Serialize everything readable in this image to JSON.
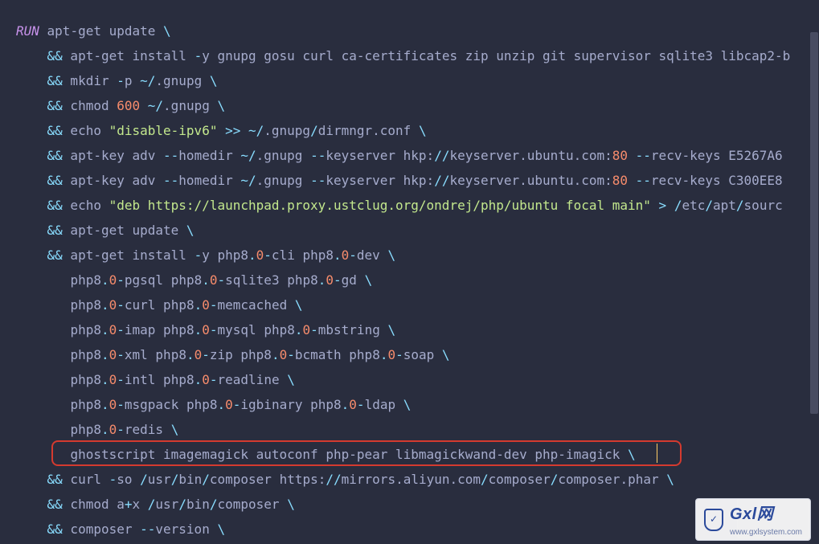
{
  "code": {
    "run_kw": "RUN",
    "lines": [
      {
        "indent": 0,
        "prefix_kw": true,
        "amp": false,
        "segs": [
          {
            "t": "txt",
            "v": " apt-get update "
          },
          {
            "t": "op",
            "v": "\\"
          }
        ]
      },
      {
        "indent": 4,
        "amp": true,
        "segs": [
          {
            "t": "txt",
            "v": " apt-get install "
          },
          {
            "t": "op",
            "v": "-"
          },
          {
            "t": "txt",
            "v": "y gnupg gosu curl ca-certificates zip unzip git supervisor sqlite3 libcap2-b"
          }
        ]
      },
      {
        "indent": 4,
        "amp": true,
        "segs": [
          {
            "t": "txt",
            "v": " mkdir "
          },
          {
            "t": "op",
            "v": "-"
          },
          {
            "t": "txt",
            "v": "p "
          },
          {
            "t": "op",
            "v": "~/"
          },
          {
            "t": "txt",
            "v": ".gnupg "
          },
          {
            "t": "op",
            "v": "\\"
          }
        ]
      },
      {
        "indent": 4,
        "amp": true,
        "segs": [
          {
            "t": "txt",
            "v": " chmod "
          },
          {
            "t": "num",
            "v": "600"
          },
          {
            "t": "txt",
            "v": " "
          },
          {
            "t": "op",
            "v": "~/"
          },
          {
            "t": "txt",
            "v": ".gnupg "
          },
          {
            "t": "op",
            "v": "\\"
          }
        ]
      },
      {
        "indent": 4,
        "amp": true,
        "segs": [
          {
            "t": "txt",
            "v": " echo "
          },
          {
            "t": "str",
            "v": "\"disable-ipv6\""
          },
          {
            "t": "txt",
            "v": " "
          },
          {
            "t": "op",
            "v": ">>"
          },
          {
            "t": "txt",
            "v": " "
          },
          {
            "t": "op",
            "v": "~/"
          },
          {
            "t": "txt",
            "v": ".gnupg"
          },
          {
            "t": "op",
            "v": "/"
          },
          {
            "t": "txt",
            "v": "dirmngr.conf "
          },
          {
            "t": "op",
            "v": "\\"
          }
        ]
      },
      {
        "indent": 4,
        "amp": true,
        "segs": [
          {
            "t": "txt",
            "v": " apt-key adv "
          },
          {
            "t": "op",
            "v": "--"
          },
          {
            "t": "txt",
            "v": "homedir "
          },
          {
            "t": "op",
            "v": "~/"
          },
          {
            "t": "txt",
            "v": ".gnupg "
          },
          {
            "t": "op",
            "v": "--"
          },
          {
            "t": "txt",
            "v": "keyserver hkp:"
          },
          {
            "t": "op",
            "v": "//"
          },
          {
            "t": "txt",
            "v": "keyserver.ubuntu.com:"
          },
          {
            "t": "num",
            "v": "80"
          },
          {
            "t": "txt",
            "v": " "
          },
          {
            "t": "op",
            "v": "--"
          },
          {
            "t": "txt",
            "v": "recv-keys E5267A6"
          }
        ]
      },
      {
        "indent": 4,
        "amp": true,
        "segs": [
          {
            "t": "txt",
            "v": " apt-key adv "
          },
          {
            "t": "op",
            "v": "--"
          },
          {
            "t": "txt",
            "v": "homedir "
          },
          {
            "t": "op",
            "v": "~/"
          },
          {
            "t": "txt",
            "v": ".gnupg "
          },
          {
            "t": "op",
            "v": "--"
          },
          {
            "t": "txt",
            "v": "keyserver hkp:"
          },
          {
            "t": "op",
            "v": "//"
          },
          {
            "t": "txt",
            "v": "keyserver.ubuntu.com:"
          },
          {
            "t": "num",
            "v": "80"
          },
          {
            "t": "txt",
            "v": " "
          },
          {
            "t": "op",
            "v": "--"
          },
          {
            "t": "txt",
            "v": "recv-keys C300EE8"
          }
        ]
      },
      {
        "indent": 4,
        "amp": true,
        "segs": [
          {
            "t": "txt",
            "v": " echo "
          },
          {
            "t": "str",
            "v": "\"deb https://launchpad.proxy.ustclug.org/ondrej/php/ubuntu focal main\""
          },
          {
            "t": "txt",
            "v": " "
          },
          {
            "t": "op",
            "v": ">"
          },
          {
            "t": "txt",
            "v": " "
          },
          {
            "t": "op",
            "v": "/"
          },
          {
            "t": "txt",
            "v": "etc"
          },
          {
            "t": "op",
            "v": "/"
          },
          {
            "t": "txt",
            "v": "apt"
          },
          {
            "t": "op",
            "v": "/"
          },
          {
            "t": "txt",
            "v": "sourc"
          }
        ]
      },
      {
        "indent": 4,
        "amp": true,
        "segs": [
          {
            "t": "txt",
            "v": " apt-get update "
          },
          {
            "t": "op",
            "v": "\\"
          }
        ]
      },
      {
        "indent": 4,
        "amp": true,
        "segs": [
          {
            "t": "txt",
            "v": " apt-get install "
          },
          {
            "t": "op",
            "v": "-"
          },
          {
            "t": "txt",
            "v": "y php8"
          },
          {
            "t": "op",
            "v": "."
          },
          {
            "t": "num",
            "v": "0"
          },
          {
            "t": "op",
            "v": "-"
          },
          {
            "t": "txt",
            "v": "cli php8"
          },
          {
            "t": "op",
            "v": "."
          },
          {
            "t": "num",
            "v": "0"
          },
          {
            "t": "op",
            "v": "-"
          },
          {
            "t": "txt",
            "v": "dev "
          },
          {
            "t": "op",
            "v": "\\"
          }
        ]
      },
      {
        "indent": 7,
        "amp": false,
        "segs": [
          {
            "t": "txt",
            "v": "php8"
          },
          {
            "t": "op",
            "v": "."
          },
          {
            "t": "num",
            "v": "0"
          },
          {
            "t": "op",
            "v": "-"
          },
          {
            "t": "txt",
            "v": "pgsql php8"
          },
          {
            "t": "op",
            "v": "."
          },
          {
            "t": "num",
            "v": "0"
          },
          {
            "t": "op",
            "v": "-"
          },
          {
            "t": "txt",
            "v": "sqlite3 php8"
          },
          {
            "t": "op",
            "v": "."
          },
          {
            "t": "num",
            "v": "0"
          },
          {
            "t": "op",
            "v": "-"
          },
          {
            "t": "txt",
            "v": "gd "
          },
          {
            "t": "op",
            "v": "\\"
          }
        ]
      },
      {
        "indent": 7,
        "amp": false,
        "segs": [
          {
            "t": "txt",
            "v": "php8"
          },
          {
            "t": "op",
            "v": "."
          },
          {
            "t": "num",
            "v": "0"
          },
          {
            "t": "op",
            "v": "-"
          },
          {
            "t": "txt",
            "v": "curl php8"
          },
          {
            "t": "op",
            "v": "."
          },
          {
            "t": "num",
            "v": "0"
          },
          {
            "t": "op",
            "v": "-"
          },
          {
            "t": "txt",
            "v": "memcached "
          },
          {
            "t": "op",
            "v": "\\"
          }
        ]
      },
      {
        "indent": 7,
        "amp": false,
        "segs": [
          {
            "t": "txt",
            "v": "php8"
          },
          {
            "t": "op",
            "v": "."
          },
          {
            "t": "num",
            "v": "0"
          },
          {
            "t": "op",
            "v": "-"
          },
          {
            "t": "txt",
            "v": "imap php8"
          },
          {
            "t": "op",
            "v": "."
          },
          {
            "t": "num",
            "v": "0"
          },
          {
            "t": "op",
            "v": "-"
          },
          {
            "t": "txt",
            "v": "mysql php8"
          },
          {
            "t": "op",
            "v": "."
          },
          {
            "t": "num",
            "v": "0"
          },
          {
            "t": "op",
            "v": "-"
          },
          {
            "t": "txt",
            "v": "mbstring "
          },
          {
            "t": "op",
            "v": "\\"
          }
        ]
      },
      {
        "indent": 7,
        "amp": false,
        "segs": [
          {
            "t": "txt",
            "v": "php8"
          },
          {
            "t": "op",
            "v": "."
          },
          {
            "t": "num",
            "v": "0"
          },
          {
            "t": "op",
            "v": "-"
          },
          {
            "t": "txt",
            "v": "xml php8"
          },
          {
            "t": "op",
            "v": "."
          },
          {
            "t": "num",
            "v": "0"
          },
          {
            "t": "op",
            "v": "-"
          },
          {
            "t": "txt",
            "v": "zip php8"
          },
          {
            "t": "op",
            "v": "."
          },
          {
            "t": "num",
            "v": "0"
          },
          {
            "t": "op",
            "v": "-"
          },
          {
            "t": "txt",
            "v": "bcmath php8"
          },
          {
            "t": "op",
            "v": "."
          },
          {
            "t": "num",
            "v": "0"
          },
          {
            "t": "op",
            "v": "-"
          },
          {
            "t": "txt",
            "v": "soap "
          },
          {
            "t": "op",
            "v": "\\"
          }
        ]
      },
      {
        "indent": 7,
        "amp": false,
        "segs": [
          {
            "t": "txt",
            "v": "php8"
          },
          {
            "t": "op",
            "v": "."
          },
          {
            "t": "num",
            "v": "0"
          },
          {
            "t": "op",
            "v": "-"
          },
          {
            "t": "txt",
            "v": "intl php8"
          },
          {
            "t": "op",
            "v": "."
          },
          {
            "t": "num",
            "v": "0"
          },
          {
            "t": "op",
            "v": "-"
          },
          {
            "t": "txt",
            "v": "readline "
          },
          {
            "t": "op",
            "v": "\\"
          }
        ]
      },
      {
        "indent": 7,
        "amp": false,
        "segs": [
          {
            "t": "txt",
            "v": "php8"
          },
          {
            "t": "op",
            "v": "."
          },
          {
            "t": "num",
            "v": "0"
          },
          {
            "t": "op",
            "v": "-"
          },
          {
            "t": "txt",
            "v": "msgpack php8"
          },
          {
            "t": "op",
            "v": "."
          },
          {
            "t": "num",
            "v": "0"
          },
          {
            "t": "op",
            "v": "-"
          },
          {
            "t": "txt",
            "v": "igbinary php8"
          },
          {
            "t": "op",
            "v": "."
          },
          {
            "t": "num",
            "v": "0"
          },
          {
            "t": "op",
            "v": "-"
          },
          {
            "t": "txt",
            "v": "ldap "
          },
          {
            "t": "op",
            "v": "\\"
          }
        ]
      },
      {
        "indent": 7,
        "amp": false,
        "segs": [
          {
            "t": "txt",
            "v": "php8"
          },
          {
            "t": "op",
            "v": "."
          },
          {
            "t": "num",
            "v": "0"
          },
          {
            "t": "op",
            "v": "-"
          },
          {
            "t": "txt",
            "v": "redis "
          },
          {
            "t": "op",
            "v": "\\"
          }
        ]
      },
      {
        "indent": 7,
        "amp": false,
        "highlight": true,
        "segs": [
          {
            "t": "txt",
            "v": "ghostscript imagemagick autoconf php-pear libmagickwand-dev php-imagick "
          },
          {
            "t": "op",
            "v": "\\"
          }
        ]
      },
      {
        "indent": 4,
        "amp": true,
        "segs": [
          {
            "t": "txt",
            "v": " curl "
          },
          {
            "t": "op",
            "v": "-"
          },
          {
            "t": "txt",
            "v": "so "
          },
          {
            "t": "op",
            "v": "/"
          },
          {
            "t": "txt",
            "v": "usr"
          },
          {
            "t": "op",
            "v": "/"
          },
          {
            "t": "txt",
            "v": "bin"
          },
          {
            "t": "op",
            "v": "/"
          },
          {
            "t": "txt",
            "v": "composer https:"
          },
          {
            "t": "op",
            "v": "//"
          },
          {
            "t": "txt",
            "v": "mirrors.aliyun.com"
          },
          {
            "t": "op",
            "v": "/"
          },
          {
            "t": "txt",
            "v": "composer"
          },
          {
            "t": "op",
            "v": "/"
          },
          {
            "t": "txt",
            "v": "composer.phar "
          },
          {
            "t": "op",
            "v": "\\"
          }
        ]
      },
      {
        "indent": 4,
        "amp": true,
        "segs": [
          {
            "t": "txt",
            "v": " chmod a"
          },
          {
            "t": "op",
            "v": "+"
          },
          {
            "t": "txt",
            "v": "x "
          },
          {
            "t": "op",
            "v": "/"
          },
          {
            "t": "txt",
            "v": "usr"
          },
          {
            "t": "op",
            "v": "/"
          },
          {
            "t": "txt",
            "v": "bin"
          },
          {
            "t": "op",
            "v": "/"
          },
          {
            "t": "txt",
            "v": "composer "
          },
          {
            "t": "op",
            "v": "\\"
          }
        ]
      },
      {
        "indent": 4,
        "amp": true,
        "segs": [
          {
            "t": "txt",
            "v": " composer "
          },
          {
            "t": "op",
            "v": "--"
          },
          {
            "t": "txt",
            "v": "version "
          },
          {
            "t": "op",
            "v": "\\"
          }
        ]
      }
    ]
  },
  "watermark": {
    "brand": "Gxl网",
    "url": "www.gxlsystem.com",
    "shield_glyph": "✓"
  },
  "amp_token": "&&"
}
